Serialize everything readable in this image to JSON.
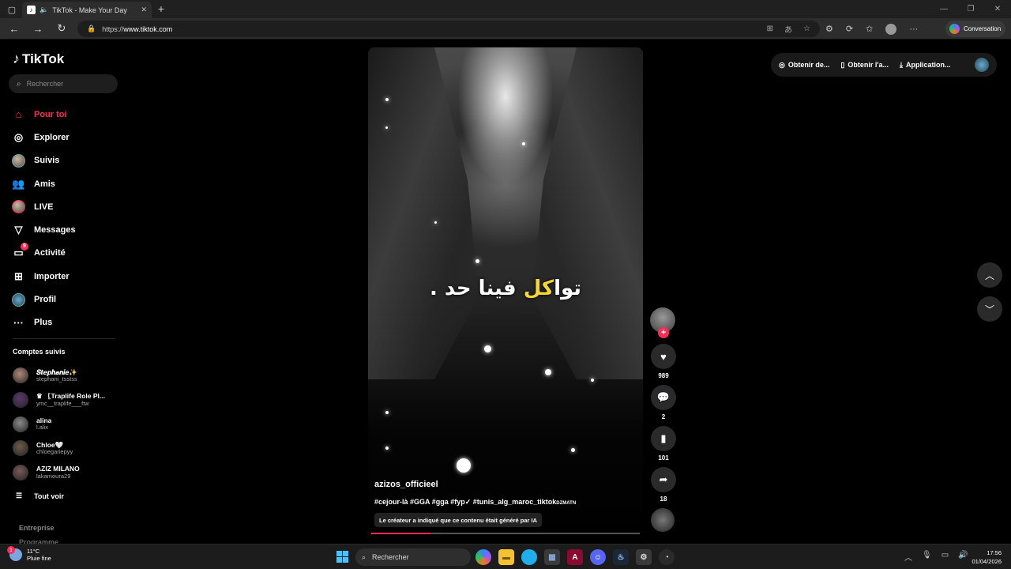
{
  "browser": {
    "tab_title": "TikTok - Make Your Day",
    "url_prefix": "https://",
    "url_host": "www.tiktok.com",
    "conversation_label": "Conversation"
  },
  "app": {
    "logo": "TikTok",
    "search_placeholder": "Rechercher"
  },
  "nav": [
    {
      "label": "Pour toi",
      "icon": "home-icon",
      "active": true
    },
    {
      "label": "Explorer",
      "icon": "compass-icon"
    },
    {
      "label": "Suivis",
      "icon": "avatar-icon"
    },
    {
      "label": "Amis",
      "icon": "friends-icon"
    },
    {
      "label": "LIVE",
      "icon": "live-icon"
    },
    {
      "label": "Messages",
      "icon": "send-icon"
    },
    {
      "label": "Activité",
      "icon": "activity-icon",
      "badge": "9"
    },
    {
      "label": "Importer",
      "icon": "upload-icon"
    },
    {
      "label": "Profil",
      "icon": "profile-icon"
    },
    {
      "label": "Plus",
      "icon": "more-icon"
    }
  ],
  "followed": {
    "heading": "Comptes suivis",
    "accounts": [
      {
        "name": "𝑺𝒕𝒆𝒑𝒉𝒂𝒏𝒊𝒆✨",
        "handle": "stephani_tsstss",
        "color": "#b08a78"
      },
      {
        "name": "♛ 〖Traplife Role Pl...",
        "handle": "ymc__traplife___ftw",
        "color": "#5a3a6a"
      },
      {
        "name": "alina",
        "handle": "l.alix",
        "color": "#8a8a8a"
      },
      {
        "name": "Chloe🤍",
        "handle": "chloegariepyy",
        "color": "#6b5a4a"
      },
      {
        "name": "AZIZ MILANO",
        "handle": "lakamoura29",
        "color": "#7a5a5a"
      }
    ],
    "see_all": "Tout voir"
  },
  "footer": {
    "line1": "Entreprise",
    "line2": "Programme"
  },
  "video": {
    "caption_part1": "توا",
    "caption_highlight": "كل",
    "caption_part2": " فينا حد .",
    "username": "azizos_officieel",
    "hashtags": "#cejour-là #GGA #gga #fyp✓ #tunis_alg_maroc_tiktok",
    "hashtags_small": "DZMATN",
    "ai_notice": "Le créateur a indiqué que ce contenu était généré par IA",
    "progress": 0.22
  },
  "actions": {
    "likes": "989",
    "comments": "2",
    "saves": "101",
    "shares": "18"
  },
  "top_pill": {
    "item1": "Obtenir de...",
    "item2": "Obtenir l'a...",
    "item3": "Application..."
  },
  "taskbar": {
    "temp": "11°C",
    "weather": "Pluie fine",
    "weather_badge": "1",
    "search": "Rechercher",
    "time": "17:56",
    "date": "01/04/2026"
  }
}
